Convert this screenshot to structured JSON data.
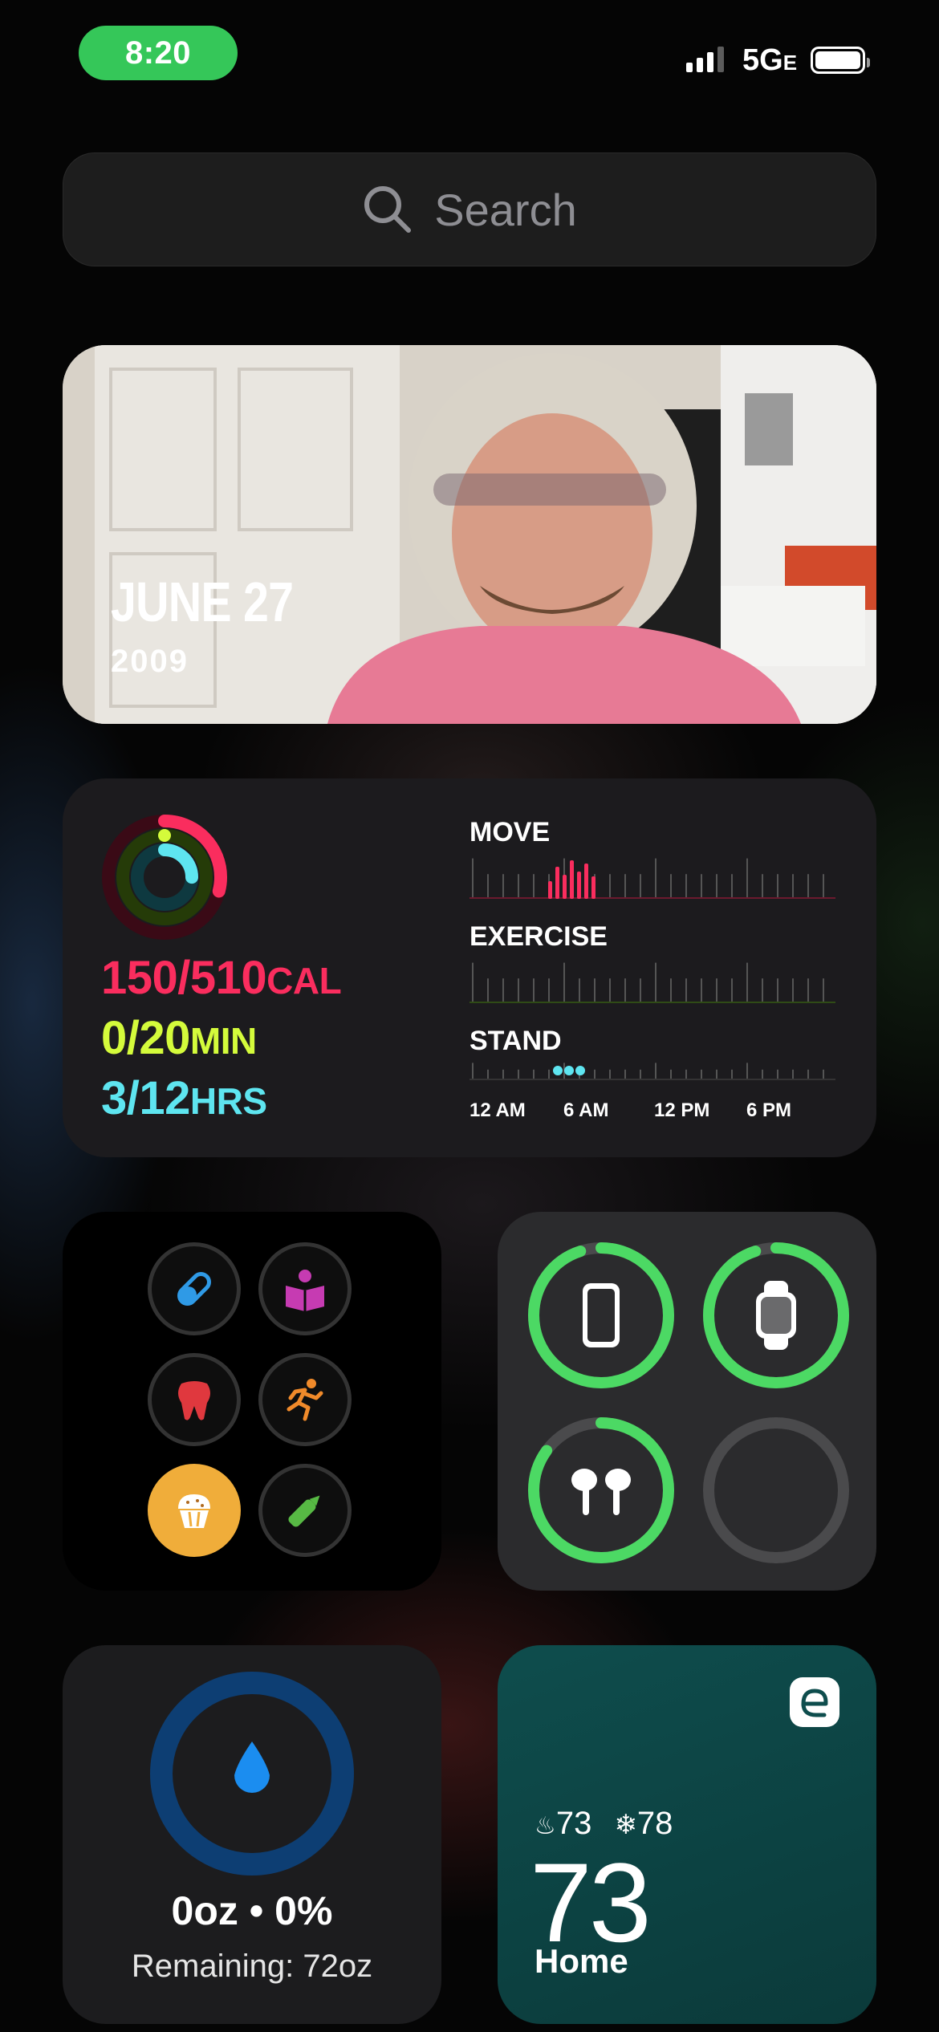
{
  "status_bar": {
    "time": "8:20",
    "network": "5G",
    "network_suffix": "E",
    "signal_bars": 3,
    "battery_level": 1.0,
    "time_pill_color": "#35c759"
  },
  "search": {
    "placeholder": "Search"
  },
  "photo_widget": {
    "date": "JUNE 27",
    "year": "2009"
  },
  "activity_widget": {
    "move": {
      "value": "150/510",
      "unit": "CAL",
      "color": "#fa2d5e",
      "progress": 0.29
    },
    "exercise": {
      "value": "0/20",
      "unit": "MIN",
      "color": "#d4fb3b",
      "progress": 0.0
    },
    "stand": {
      "value": "3/12",
      "unit": "HRS",
      "color": "#5ee5f0",
      "progress": 0.25
    },
    "move_label": "MOVE",
    "exercise_label": "EXERCISE",
    "stand_label": "STAND",
    "time_labels": [
      "12 AM",
      "6 AM",
      "12 PM",
      "6 PM"
    ]
  },
  "shortcuts_widget": {
    "items": [
      {
        "icon": "pill-icon",
        "color": "#2f9ae6"
      },
      {
        "icon": "reading-book-icon",
        "color": "#c63bb2"
      },
      {
        "icon": "tooth-icon",
        "color": "#e0383e"
      },
      {
        "icon": "running-figure-icon",
        "color": "#f08a2a"
      },
      {
        "icon": "muffin-icon",
        "color": "#f0ad3a"
      },
      {
        "icon": "marker-pen-icon",
        "color": "#57b944"
      }
    ]
  },
  "batteries_widget": {
    "devices": [
      {
        "name": "iphone-icon",
        "level": 0.95
      },
      {
        "name": "watch-icon",
        "level": 0.95
      },
      {
        "name": "airpods-icon",
        "level": 0.85
      },
      {
        "name": "empty-slot",
        "level": 0
      }
    ],
    "ring_color": "#4cd964"
  },
  "water_widget": {
    "summary": "0oz • 0%",
    "remaining": "Remaining: 72oz",
    "ring_color": "#0d3e73",
    "drop_color": "#1b8df0"
  },
  "ecobee_widget": {
    "heat_setpoint": "73",
    "cool_setpoint": "78",
    "current_temp": "73",
    "location": "Home"
  }
}
